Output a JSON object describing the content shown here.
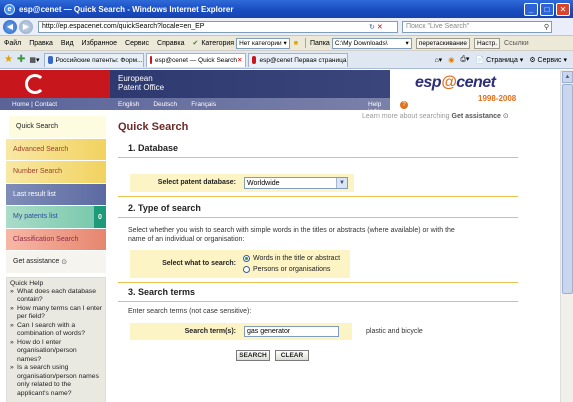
{
  "window": {
    "title": "esp@cenet — Quick Search - Windows Internet Explorer"
  },
  "address_bar": {
    "url": "http://ep.espacenet.com/quickSearch?locale=en_EP",
    "search_placeholder": "Поиск \"Live Search\""
  },
  "menu": {
    "items": [
      "Файл",
      "Правка",
      "Вид",
      "Избранное",
      "Сервис",
      "Справка"
    ],
    "category_label": "Категория",
    "category_value": "Нет категории",
    "folder_label": "Папка",
    "folder_value": "C:\\My Downloads\\",
    "drag_button": "перетаскивание",
    "settings_button": "Настр.",
    "links_label": "Ссылки"
  },
  "tabs": [
    {
      "label": "Российские патенты: Форм...",
      "color": "#3a68c8"
    },
    {
      "label": "esp@cenet — Quick Search",
      "color": "#c8161d"
    },
    {
      "label": "esp@cenet Первая страница",
      "color": "#c8161d"
    }
  ],
  "toolbar_right": {
    "page": "Страница",
    "service": "Сервис"
  },
  "header": {
    "org_line1": "European",
    "org_line2": "Patent Office",
    "brand_pre": "esp",
    "brand_at": "@",
    "brand_post": "cenet",
    "years": "1998-2008",
    "home_contact": "Home | Contact",
    "languages": [
      "English",
      "Deutsch",
      "Français"
    ],
    "help_index": "Help index",
    "help_icon": "?"
  },
  "sidebar": {
    "items": [
      {
        "label": "Quick Search"
      },
      {
        "label": "Advanced Search"
      },
      {
        "label": "Number Search"
      },
      {
        "label": "Last result list"
      },
      {
        "label": "My patents list",
        "badge": "0"
      },
      {
        "label": "Classification Search"
      },
      {
        "label": "Get assistance",
        "icon": "⊙"
      }
    ],
    "quick_help": {
      "title": "Quick Help",
      "items": [
        "What does each database contain?",
        "How many terms can I enter per field?",
        "Can I search with a combination of words?",
        "How do I enter organisation/person names?",
        "Is a search using organisation/person names only related to the applicant's name?"
      ]
    }
  },
  "main": {
    "learn_more_prefix": "Learn more about searching",
    "learn_more_link": "Get assistance",
    "title": "Quick Search",
    "section1": {
      "heading": "1. Database",
      "label": "Select patent database:",
      "value": "Worldwide"
    },
    "section2": {
      "heading": "2. Type of search",
      "description": "Select whether you wish to search with simple words in the titles or abstracts (where available) or with the name of an individual or organisation:",
      "label": "Select what to search:",
      "options": [
        "Words in the title or abstract",
        "Persons or organisations"
      ],
      "selected_index": 0
    },
    "section3": {
      "heading": "3. Search terms",
      "description": "Enter search terms (not case sensitive):",
      "label": "Search term(s):",
      "value": "gas generator",
      "example": "plastic and bicycle"
    },
    "buttons": {
      "search": "SEARCH",
      "clear": "CLEAR"
    }
  }
}
